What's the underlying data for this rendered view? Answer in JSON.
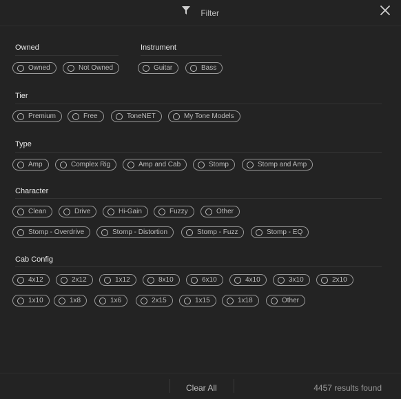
{
  "header": {
    "title": "Filter"
  },
  "sections": {
    "owned": {
      "title": "Owned",
      "options": [
        "Owned",
        "Not Owned"
      ]
    },
    "instrument": {
      "title": "Instrument",
      "options": [
        "Guitar",
        "Bass"
      ]
    },
    "tier": {
      "title": "Tier",
      "options": [
        "Premium",
        "Free",
        "ToneNET",
        "My Tone Models"
      ]
    },
    "type": {
      "title": "Type",
      "options": [
        "Amp",
        "Complex Rig",
        "Amp and Cab",
        "Stomp",
        "Stomp and Amp"
      ]
    },
    "character": {
      "title": "Character",
      "options": [
        "Clean",
        "Drive",
        "Hi-Gain",
        "Fuzzy",
        "Other",
        "Stomp - Overdrive",
        "Stomp - Distortion",
        "Stomp - Fuzz",
        "Stomp - EQ"
      ]
    },
    "cab_config": {
      "title": "Cab Config",
      "options": [
        "4x12",
        "2x12",
        "1x12",
        "8x10",
        "6x10",
        "4x10",
        "3x10",
        "2x10",
        "1x10",
        "1x8",
        "1x6",
        "2x15",
        "1x15",
        "1x18",
        "Other"
      ]
    }
  },
  "footer": {
    "clear_all": "Clear All",
    "results": "4457 results found"
  },
  "icons": {
    "filter": "filter-icon",
    "close": "close-icon",
    "radio": "radio-unselected-icon"
  },
  "colors": {
    "background": "#232323",
    "chip_border": "#9a9a9a",
    "text": "#d6d6d6"
  }
}
